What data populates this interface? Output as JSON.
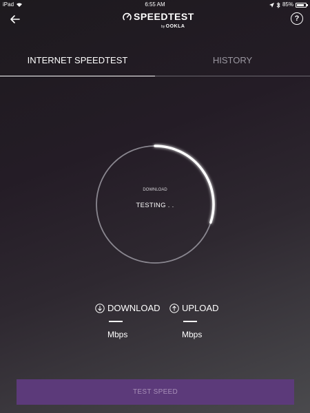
{
  "status_bar": {
    "device": "iPad",
    "time": "6:55 AM",
    "battery_text": "85%",
    "battery_level": 0.85
  },
  "header": {
    "logo_title": "SPEEDTEST",
    "logo_by": "by",
    "logo_brand": "OOKLA",
    "back_icon": "arrow-left-icon",
    "help_icon": "question-circle-icon",
    "help_text": "?"
  },
  "tabs": [
    {
      "label": "INTERNET SPEEDTEST",
      "active": true
    },
    {
      "label": "HISTORY",
      "active": false
    }
  ],
  "gauge": {
    "phase_label": "DOWNLOAD",
    "status_text": "TESTING . .",
    "progress": 0.3,
    "colors": {
      "ring": "#8a8790",
      "progress": "#ffffff"
    }
  },
  "metrics": {
    "download": {
      "label": "DOWNLOAD",
      "value": "—",
      "unit": "Mbps",
      "icon": "arrow-down-circle-icon"
    },
    "upload": {
      "label": "UPLOAD",
      "value": "—",
      "unit": "Mbps",
      "icon": "arrow-up-circle-icon"
    }
  },
  "actions": {
    "test_speed_label": "TEST SPEED"
  },
  "colors": {
    "accent": "#5c3a7a",
    "button_text": "#a890b8"
  }
}
